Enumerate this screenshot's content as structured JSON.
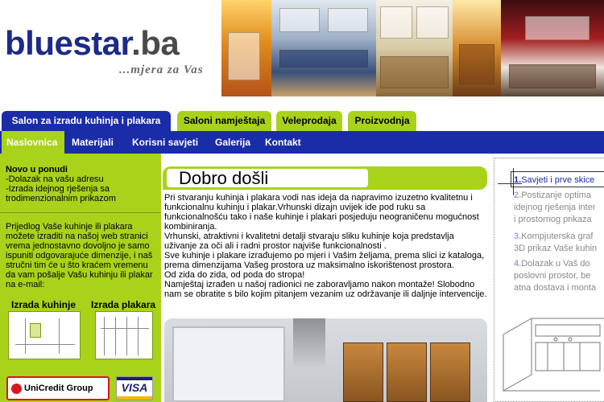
{
  "header": {
    "logo_main": "bluestar",
    "logo_tld": ".ba",
    "slogan": "...mjera za Vas"
  },
  "tabs_top": [
    {
      "label": "Salon za izradu kuhinja i plakara",
      "active": true
    },
    {
      "label": "Saloni namještaja",
      "active": false
    },
    {
      "label": "Veleprodaja",
      "active": false
    },
    {
      "label": "Proizvodnja",
      "active": false
    }
  ],
  "subnav": [
    {
      "label": "Naslovnica",
      "active": true
    },
    {
      "label": "Materijali",
      "active": false
    },
    {
      "label": "Korisni savjeti",
      "active": false
    },
    {
      "label": "Galerija",
      "active": false
    },
    {
      "label": "Kontakt",
      "active": false
    }
  ],
  "sidebar": {
    "offer_title": "Novo u ponudi",
    "offer_lines": [
      "-Dolazak na vašu adresu",
      "-Izrada idejnog rješenja sa",
      "trodimenzionalnim prikazom"
    ],
    "proposal_text": "Prijedlog Vaše kuhinje ili plakara možete izraditi na našoj web stranici vrema jednostavno dovoljno je samo ispuniti odgovarajuće dimenzije, i naš stručni tim će u što kraćem vremenu da vam pošalje Vašu kuhinju ili plakar na e-mail:",
    "label_kitchen": "Izrada kuhinje",
    "label_wardrobe": "Izrada plakara",
    "bank_name": "UniCredit Group",
    "card_name": "VISA"
  },
  "main": {
    "heading": "Dobro došli",
    "intro_paragraphs": [
      "Pri stvaranju kuhinja i plakara vodi nas ideja da napravimo izuzetno kvalitetnu i funkcionalnu kuhinju i plakar.Vrhunski dizajn uvijek ide pod ruku sa funkcionalnošću tako i naše kuhinje i plakari posjeduju neograničenu mogućnost kombiniranja.",
      "Vrhunski, atraktivni i kvalitetni detalji stvaraju sliku kuhinje koja predstavlja uživanje za oči ali i radni prostor najviše funkcionalnosti .",
      "Sve kuhinje i plakare izrađujemo po mjeri i Vašim željama, prema slici iz kataloga, prema dimenzijama Vašeg prostora uz maksimalno iskorištenost prostora.",
      "Od zida do zida, od poda do stropa!",
      "Namještaj izrađen u našoj radionici ne zaboravljamo nakon montaže! Slobodno nam se obratite s bilo kojim pitanjem vezanim uz održavanje ili daljnje intervencije."
    ]
  },
  "right_panel": {
    "items": [
      {
        "num": "1.",
        "text": "Savjeti i prve skice"
      },
      {
        "num": "2.",
        "text": "Postizanje optima",
        "lines": [
          "idejnog rješenja inter",
          "i prostornog prikaza"
        ]
      },
      {
        "num": "3.",
        "text": "Kompjuterska graf",
        "lines": [
          "3D prikaz Vaše kuhin"
        ]
      },
      {
        "num": "4.",
        "text": "Dolazak u Vaš do",
        "lines": [
          "poslovni prostor, be",
          "atna dostava i monta"
        ]
      }
    ]
  },
  "colors": {
    "brand_blue": "#1b2ca8",
    "accent_green": "#a9d21a",
    "logo_blue": "#1c2a8a"
  }
}
